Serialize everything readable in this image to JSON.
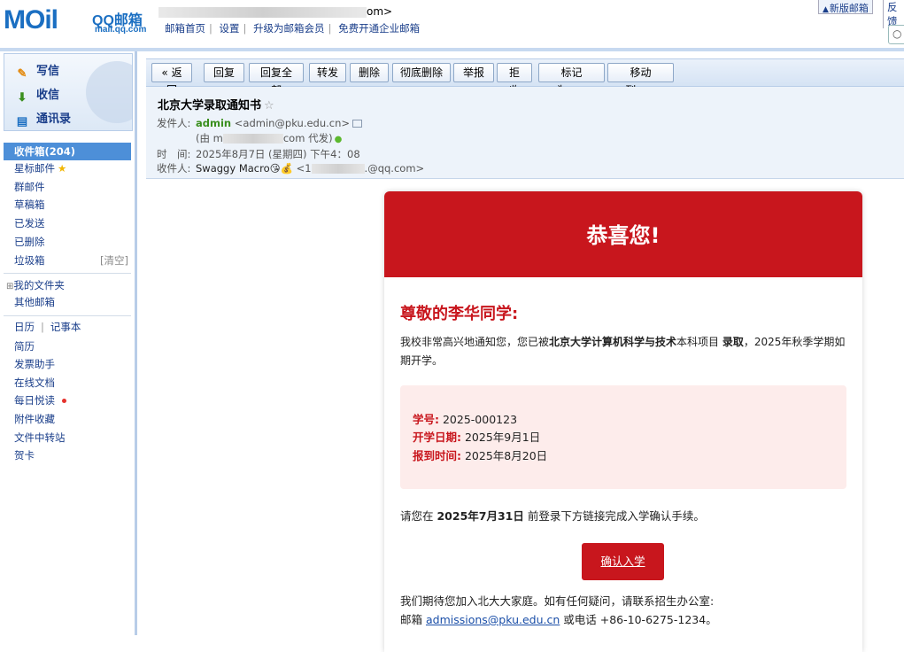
{
  "app": {
    "logo_text": "MOil",
    "logo_brand": "QQ邮箱",
    "logo_domain": "mail.qq.com",
    "account_suffix": "om>"
  },
  "topnav": [
    "邮箱首页",
    "设置",
    "升级为邮箱会员",
    "免费开通企业邮箱"
  ],
  "top_right": {
    "new_version": "新版邮箱",
    "feedback": "反馈"
  },
  "sidebar": {
    "actions": [
      {
        "icon": "pencil-icon",
        "label": "写信"
      },
      {
        "icon": "inbox-download-icon",
        "label": "收信"
      },
      {
        "icon": "contacts-icon",
        "label": "通讯录"
      }
    ],
    "folders": [
      {
        "label": "收件箱(204)"
      },
      {
        "label": "星标邮件"
      },
      {
        "label": "群邮件"
      },
      {
        "label": "草稿箱"
      },
      {
        "label": "已发送"
      },
      {
        "label": "已删除"
      },
      {
        "label": "垃圾箱",
        "action": "[清空]"
      }
    ],
    "my_folders": {
      "toggle": "⊞",
      "label": "我的文件夹"
    },
    "other": "其他邮箱",
    "tools": {
      "calendar": "日历",
      "sep": "|",
      "notes": "记事本",
      "items": [
        "简历",
        "发票助手",
        "在线文档",
        "每日悦读",
        "附件收藏",
        "文件中转站",
        "贺卡"
      ]
    }
  },
  "toolbar": {
    "buttons": [
      "« 返回",
      "回复",
      "回复全部",
      "转发",
      "删除",
      "彻底删除",
      "举报",
      "拒收"
    ],
    "dropdowns": [
      "标记为...",
      "移动到..."
    ]
  },
  "mail": {
    "subject": "北京大学录取通知书",
    "from_label": "发件人:",
    "from_name": "admin",
    "from_addr": "<admin@pku.edu.cn>",
    "via_prefix": "(由 m",
    "via_suffix": "com 代发)",
    "time_label": "时　间:",
    "time_value": "2025年8月7日 (星期四) 下午4：08",
    "to_label": "收件人:",
    "to_name": "Swaggy Macro",
    "to_addr_prefix": "<1",
    "to_addr_suffix": ".@qq.com>"
  },
  "email_body": {
    "banner": "恭喜您!",
    "greeting": "尊敬的李华同学:",
    "p1_a": "我校非常高兴地通知您，您已被",
    "p1_b": "北京大学计算机科学与技术",
    "p1_c": "本科项目 ",
    "p1_d": "录取",
    "p1_e": "，2025年秋季学期如期开学。",
    "info": [
      {
        "k": "学号:",
        "v": "2025-000123"
      },
      {
        "k": "开学日期:",
        "v": "2025年9月1日"
      },
      {
        "k": "报到时间:",
        "v": "2025年8月20日"
      }
    ],
    "p2_a": "请您在 ",
    "p2_b": "2025年7月31日",
    "p2_c": " 前登录下方链接完成入学确认手续。",
    "confirm_button": "确认入学",
    "p3_line1": "我们期待您加入北大大家庭。如有任何疑问，请联系招生办公室:",
    "p3_mail_prefix": "邮箱 ",
    "p3_mail": "admissions@pku.edu.cn",
    "p3_phone": " 或电话 +86-10-6275-1234。"
  },
  "colors": {
    "brand_red": "#c8161d",
    "link_blue": "#1a3e8a",
    "active_folder": "#4d8fd8"
  }
}
